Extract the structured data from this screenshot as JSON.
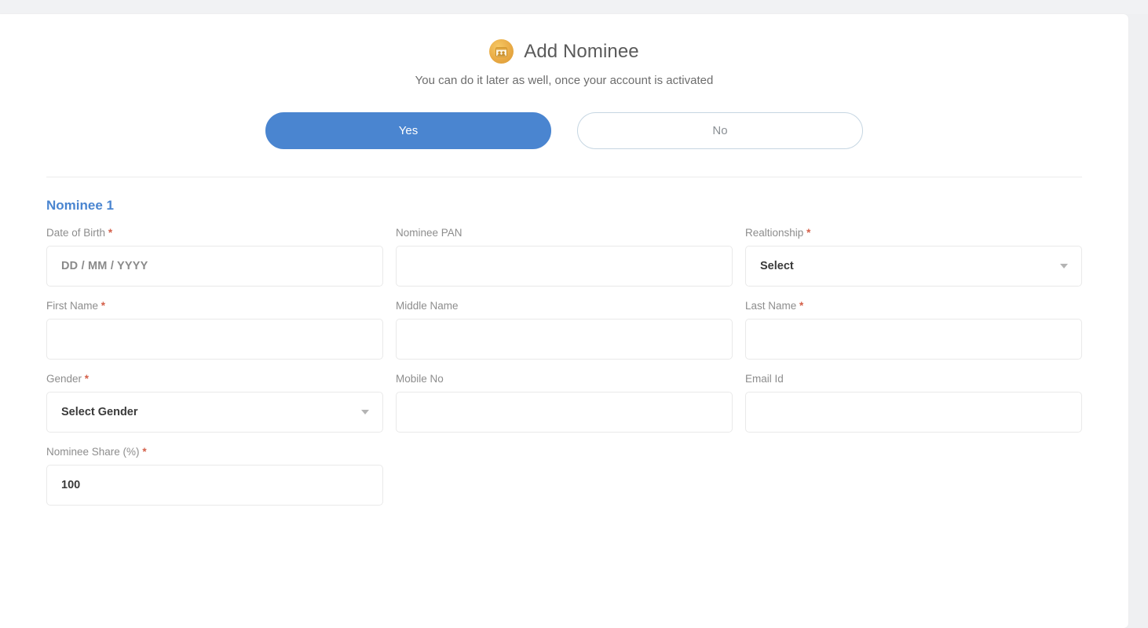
{
  "header": {
    "icon": "nominee-badge-icon",
    "title": "Add Nominee",
    "subtitle": "You can do it later as well, once your account is activated"
  },
  "choice": {
    "yes_label": "Yes",
    "no_label": "No",
    "selected": "Yes"
  },
  "section": {
    "title": "Nominee 1"
  },
  "colors": {
    "accent_blue": "#4a85d0",
    "required_red": "#d4604a",
    "label_gray": "#8d8d8d",
    "badge_gold": "#e8a944",
    "border_gray": "#e9e9e9"
  },
  "form": {
    "rows": [
      {
        "fields": [
          {
            "label": "Date of Birth",
            "required": true,
            "type": "text",
            "value": "",
            "placeholder": "DD / MM / YYYY"
          },
          {
            "label": "Nominee PAN",
            "required": false,
            "type": "text",
            "value": "",
            "placeholder": ""
          },
          {
            "label": "Realtionship",
            "required": true,
            "type": "select",
            "value": "Select",
            "placeholder": ""
          }
        ]
      },
      {
        "fields": [
          {
            "label": "First Name",
            "required": true,
            "type": "text",
            "value": "",
            "placeholder": ""
          },
          {
            "label": "Middle Name",
            "required": false,
            "type": "text",
            "value": "",
            "placeholder": ""
          },
          {
            "label": "Last Name",
            "required": true,
            "type": "text",
            "value": "",
            "placeholder": ""
          }
        ]
      },
      {
        "fields": [
          {
            "label": "Gender",
            "required": true,
            "type": "select",
            "value": "Select Gender",
            "placeholder": ""
          },
          {
            "label": "Mobile No",
            "required": false,
            "type": "text",
            "value": "",
            "placeholder": ""
          },
          {
            "label": "Email Id",
            "required": false,
            "type": "text",
            "value": "",
            "placeholder": ""
          }
        ]
      },
      {
        "fields": [
          {
            "label": "Nominee Share (%)",
            "required": true,
            "type": "text",
            "value": "100",
            "placeholder": ""
          }
        ]
      }
    ]
  }
}
